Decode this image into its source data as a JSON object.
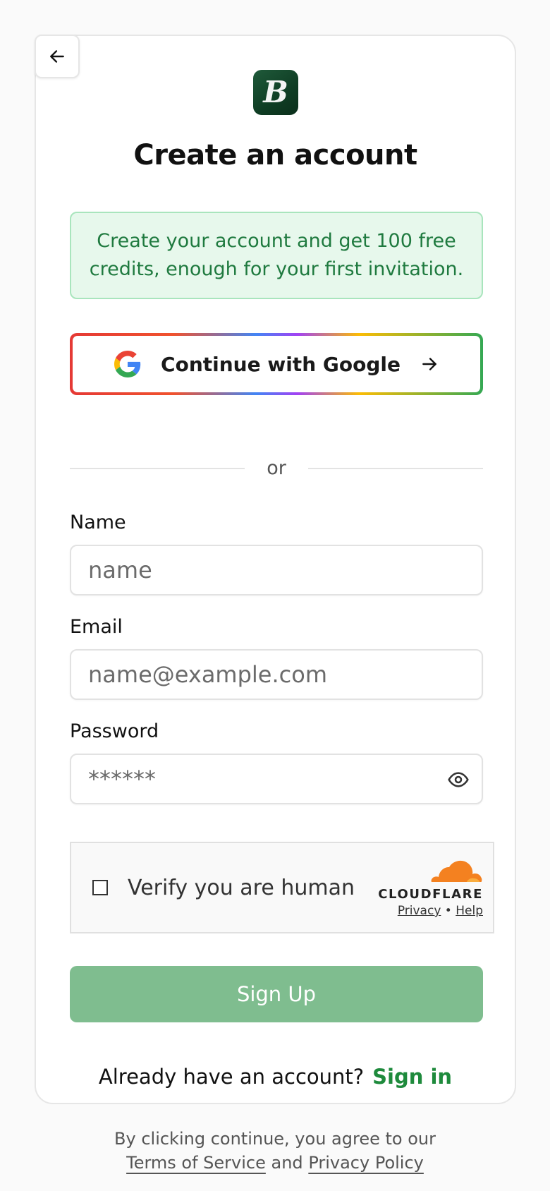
{
  "header": {
    "logo_letter": "B",
    "title": "Create an account"
  },
  "promo": {
    "text": "Create your account and get 100 free credits, enough for your first invitation."
  },
  "google": {
    "label": "Continue with Google"
  },
  "divider": {
    "text": "or"
  },
  "form": {
    "name_label": "Name",
    "name_placeholder": "name",
    "email_label": "Email",
    "email_placeholder": "name@example.com",
    "password_label": "Password",
    "password_placeholder": "******"
  },
  "captcha": {
    "label": "Verify you are human",
    "brand": "CLOUDFLARE",
    "privacy": "Privacy",
    "separator": "•",
    "help": "Help"
  },
  "signup": {
    "label": "Sign Up"
  },
  "signin": {
    "prompt": "Already have an account?",
    "link": "Sign in"
  },
  "legal": {
    "prefix": "By clicking continue, you agree to our",
    "terms": "Terms of Service",
    "and": "and",
    "privacy": "Privacy Policy"
  },
  "colors": {
    "brand_green": "#1e8a3c",
    "signup_disabled": "#7fbd8f",
    "promo_bg": "#e7f8ec",
    "cloudflare_orange": "#f48120"
  }
}
